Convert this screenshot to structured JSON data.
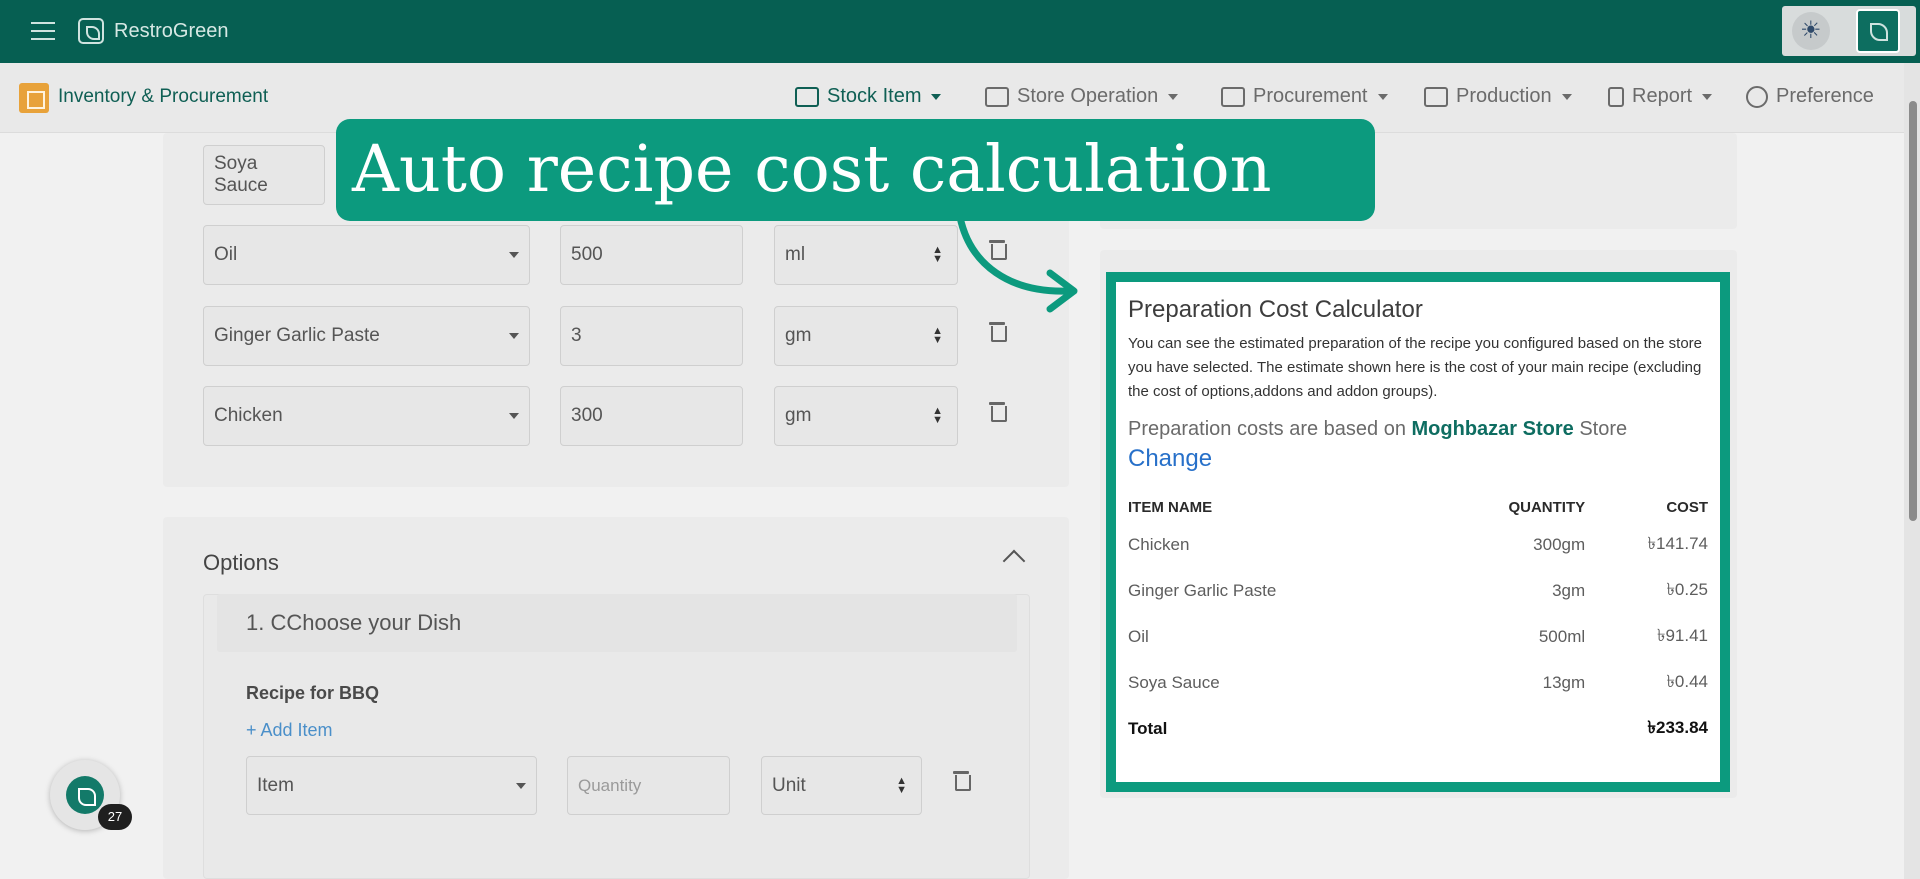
{
  "app": {
    "brand": "RestroGreen",
    "module": "Inventory & Procurement"
  },
  "nav": [
    {
      "label": "Stock Item",
      "icon": "list-icon",
      "active": true
    },
    {
      "label": "Store Operation",
      "icon": "store-icon"
    },
    {
      "label": "Procurement",
      "icon": "procurement-icon"
    },
    {
      "label": "Production",
      "icon": "production-icon"
    },
    {
      "label": "Report",
      "icon": "clipboard-icon"
    },
    {
      "label": "Preference",
      "icon": "gear-icon"
    }
  ],
  "recipe_rows": [
    {
      "item": "Soya Sauce",
      "qty": "",
      "unit": ""
    },
    {
      "item": "Oil",
      "qty": "500",
      "unit": "ml"
    },
    {
      "item": "Ginger Garlic Paste",
      "qty": "3",
      "unit": "gm"
    },
    {
      "item": "Chicken",
      "qty": "300",
      "unit": "gm"
    }
  ],
  "options": {
    "title": "Options",
    "option_head": "1. CChoose your Dish",
    "recipe_title": "Recipe for BBQ",
    "add_item": "+ Add Item",
    "item_placeholder": "Item",
    "quantity_placeholder": "Quantity",
    "unit_placeholder": "Unit"
  },
  "fab": {
    "badge": "27"
  },
  "callout": {
    "text": "Auto recipe cost calculation"
  },
  "calculator": {
    "title": "Preparation Cost Calculator",
    "description": "You can see the estimated preparation of the recipe you configured based on the store you have selected. The estimate shown here is the cost of your main recipe (excluding the cost of options,addons and addon groups).",
    "store_prefix": "Preparation costs are based on",
    "store_name": "Moghbazar Store",
    "store_suffix": "Store",
    "change_label": "Change",
    "headers": {
      "item": "ITEM NAME",
      "quantity": "QUANTITY",
      "cost": "COST"
    },
    "rows": [
      {
        "item": "Chicken",
        "quantity": "300gm",
        "cost": "৳141.74"
      },
      {
        "item": "Ginger Garlic Paste",
        "quantity": "3gm",
        "cost": "৳0.25"
      },
      {
        "item": "Oil",
        "quantity": "500ml",
        "cost": "৳91.41"
      },
      {
        "item": "Soya Sauce",
        "quantity": "13gm",
        "cost": "৳0.44"
      }
    ],
    "total_label": "Total",
    "total_value": "৳233.84"
  },
  "colors": {
    "primary": "#065f52",
    "accent": "#0c9a7e",
    "link": "#2770c9"
  }
}
